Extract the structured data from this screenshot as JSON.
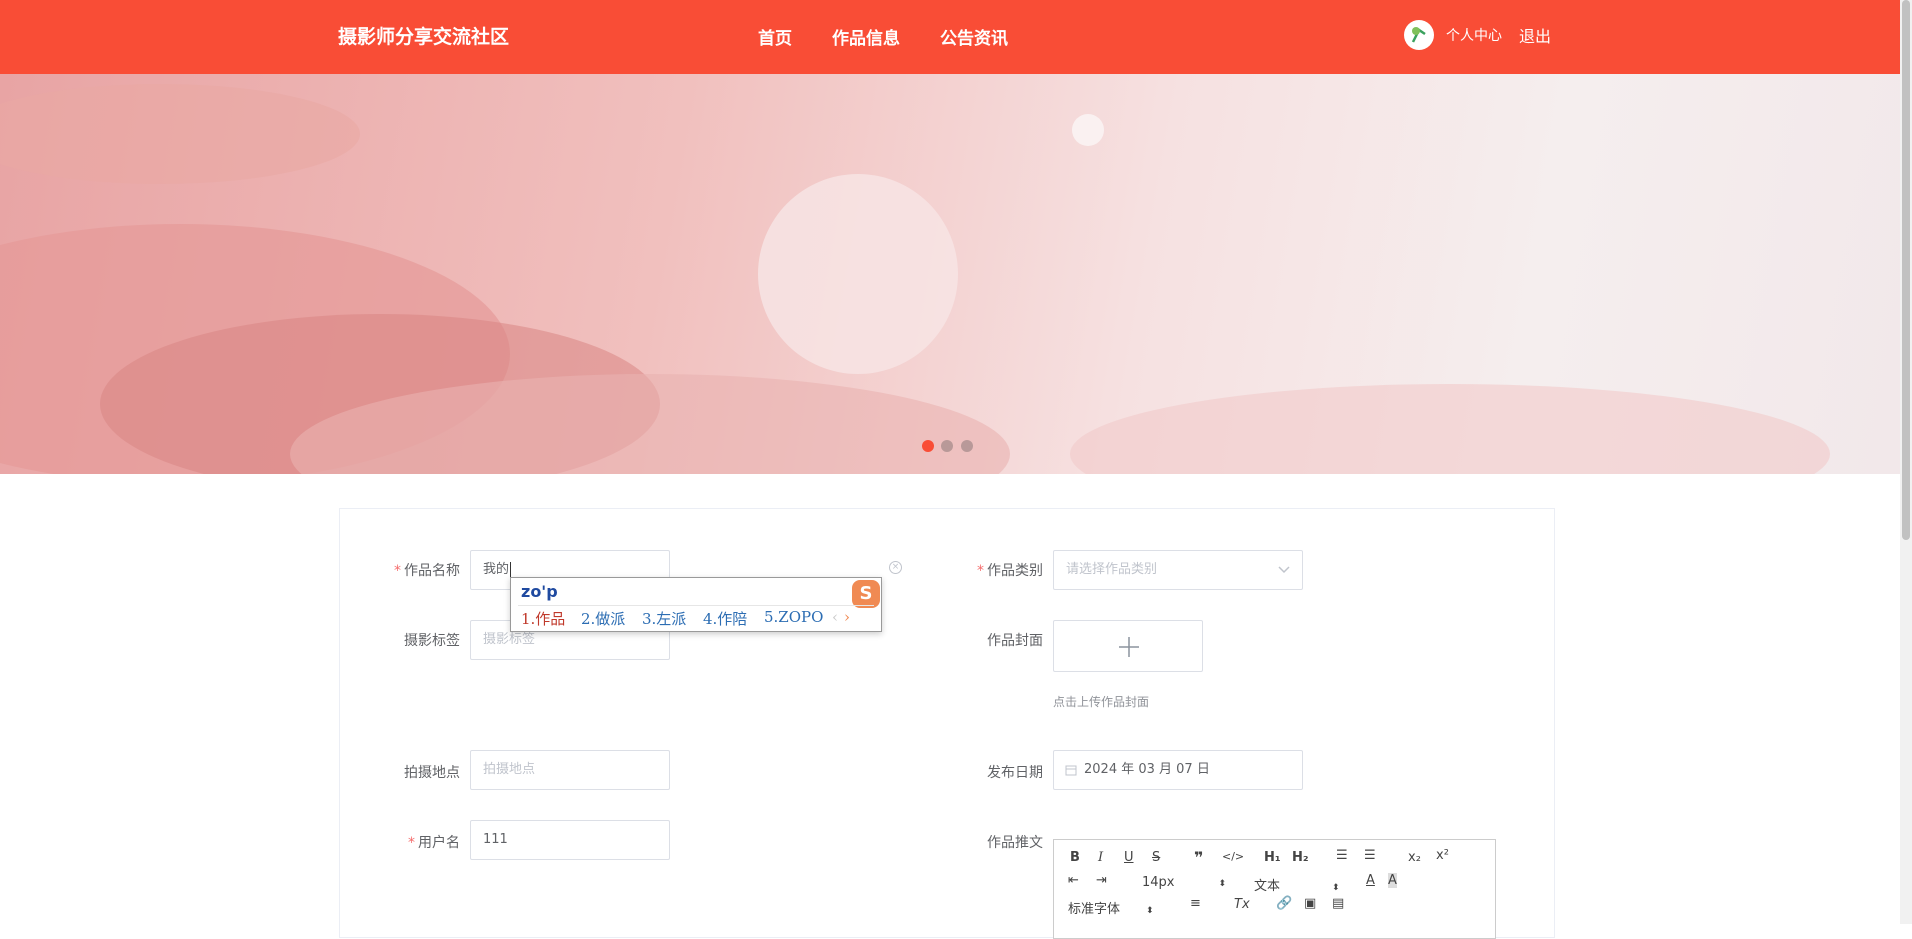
{
  "header": {
    "brand": "摄影师分享交流社区",
    "nav": [
      "首页",
      "作品信息",
      "公告资讯"
    ],
    "user_center": "个人中心",
    "logout": "退出"
  },
  "banner": {
    "slides": 3,
    "active_slide": 1
  },
  "form": {
    "title_label": "作品名称",
    "title_value": "我的",
    "category_label": "作品类别",
    "category_placeholder": "请选择作品类别",
    "tags_label": "摄影标签",
    "tags_placeholder": "摄影标签",
    "cover_label": "作品封面",
    "cover_tip": "点击上传作品封面",
    "location_label": "拍摄地点",
    "location_placeholder": "拍摄地点",
    "date_label": "发布日期",
    "date_value": "2024 年 03 月 07 日",
    "username_label": "用户名",
    "username_value": "111",
    "content_label": "作品推文"
  },
  "editor_toolbar": {
    "font_size": "14px",
    "text_type": "文本",
    "font_family": "标准字体"
  },
  "ime": {
    "composition": "zo'p",
    "candidates": [
      "1.作品",
      "2.做派",
      "3.左派",
      "4.作陪",
      "5.ZOPO"
    ]
  },
  "colors": {
    "accent": "#f94d36",
    "required": "#f56c6c"
  }
}
